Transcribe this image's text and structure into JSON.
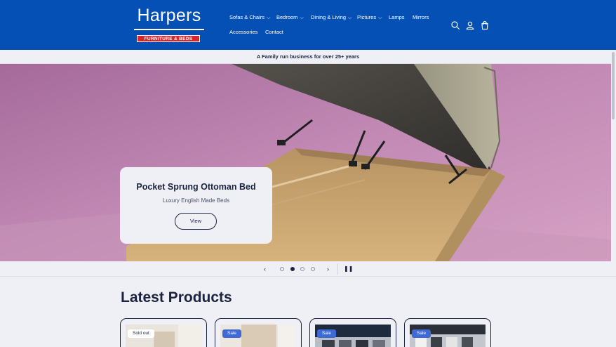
{
  "brand": {
    "name": "Harpers",
    "tagline": "FURNITURE & BEDS"
  },
  "nav": [
    {
      "label": "Sofas & Chairs",
      "dropdown": true
    },
    {
      "label": "Bedroom",
      "dropdown": true
    },
    {
      "label": "Dining & Living",
      "dropdown": true
    },
    {
      "label": "Pictures",
      "dropdown": true
    },
    {
      "label": "Lamps",
      "dropdown": false
    },
    {
      "label": "Mirrors",
      "dropdown": false
    },
    {
      "label": "Accessories",
      "dropdown": false
    },
    {
      "label": "Contact",
      "dropdown": false
    }
  ],
  "header_icons": [
    "search-icon",
    "account-icon",
    "cart-icon"
  ],
  "announcement": "A Family run business for over 25+ years",
  "hero": {
    "title": "Pocket Sprung Ottoman Bed",
    "subtitle": "Luxury English Made Beds",
    "button": "View"
  },
  "slider": {
    "slide_count": 4,
    "active_slide": 2
  },
  "products": {
    "title": "Latest Products",
    "items": [
      {
        "badge": "Sold out",
        "badge_type": "sold"
      },
      {
        "badge": "Sale",
        "badge_type": "sale"
      },
      {
        "badge": "Sale",
        "badge_type": "sale"
      },
      {
        "badge": "Sale",
        "badge_type": "sale"
      }
    ]
  },
  "colors": {
    "header_bg": "#0450b4",
    "page_bg": "#eef0f6",
    "text": "#1c2340",
    "logo_badge": "#d8262d",
    "sale_badge": "#3d6ad6"
  }
}
